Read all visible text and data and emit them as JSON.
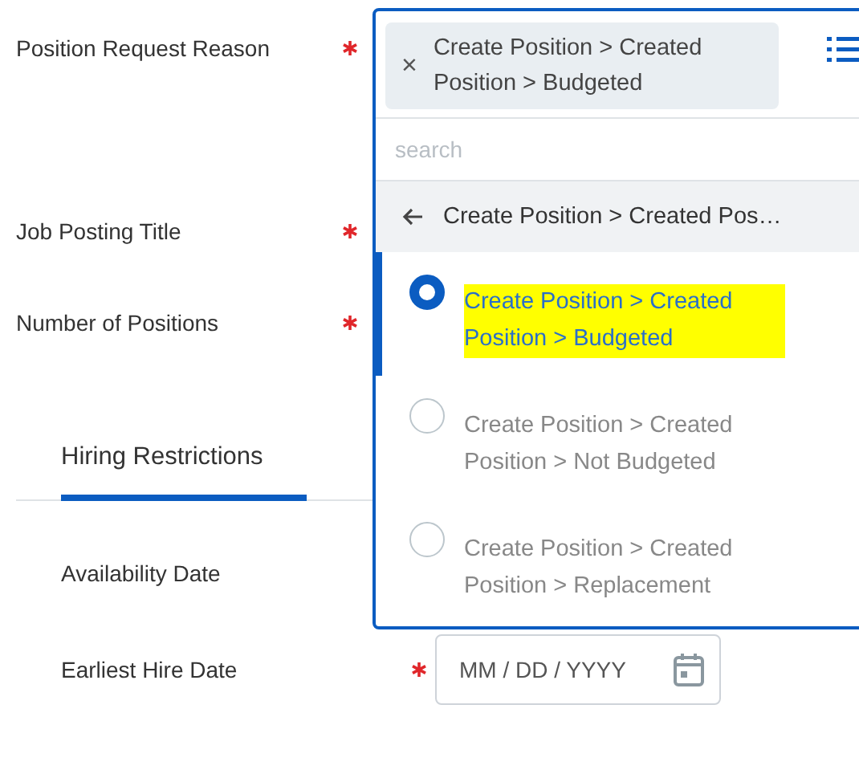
{
  "form": {
    "fields": [
      {
        "label": "Position Request Reason",
        "required": true
      },
      {
        "label": "Job Posting Title",
        "required": true
      },
      {
        "label": "Number of Positions",
        "required": true
      }
    ],
    "section_tab": {
      "label": "Hiring Restrictions",
      "selected": true
    },
    "section_fields": [
      {
        "label": "Availability Date"
      },
      {
        "label": "Earliest Hire Date",
        "required": true,
        "placeholder": "MM / DD / YYYY"
      }
    ]
  },
  "dropdown": {
    "chip": {
      "remove": "×",
      "text": "Create Position > Created Position > Budgeted"
    },
    "search": {
      "placeholder": "search"
    },
    "back": {
      "text": "Create Position > Created Pos…"
    },
    "options": [
      {
        "text": "Create Position > Created Position > Budgeted",
        "selected": true,
        "highlighted": true
      },
      {
        "text": "Create Position > Created Position > Not Budgeted",
        "selected": false,
        "highlighted": false
      },
      {
        "text": "Create Position > Created Position > Replacement",
        "selected": false,
        "highlighted": false
      }
    ]
  }
}
